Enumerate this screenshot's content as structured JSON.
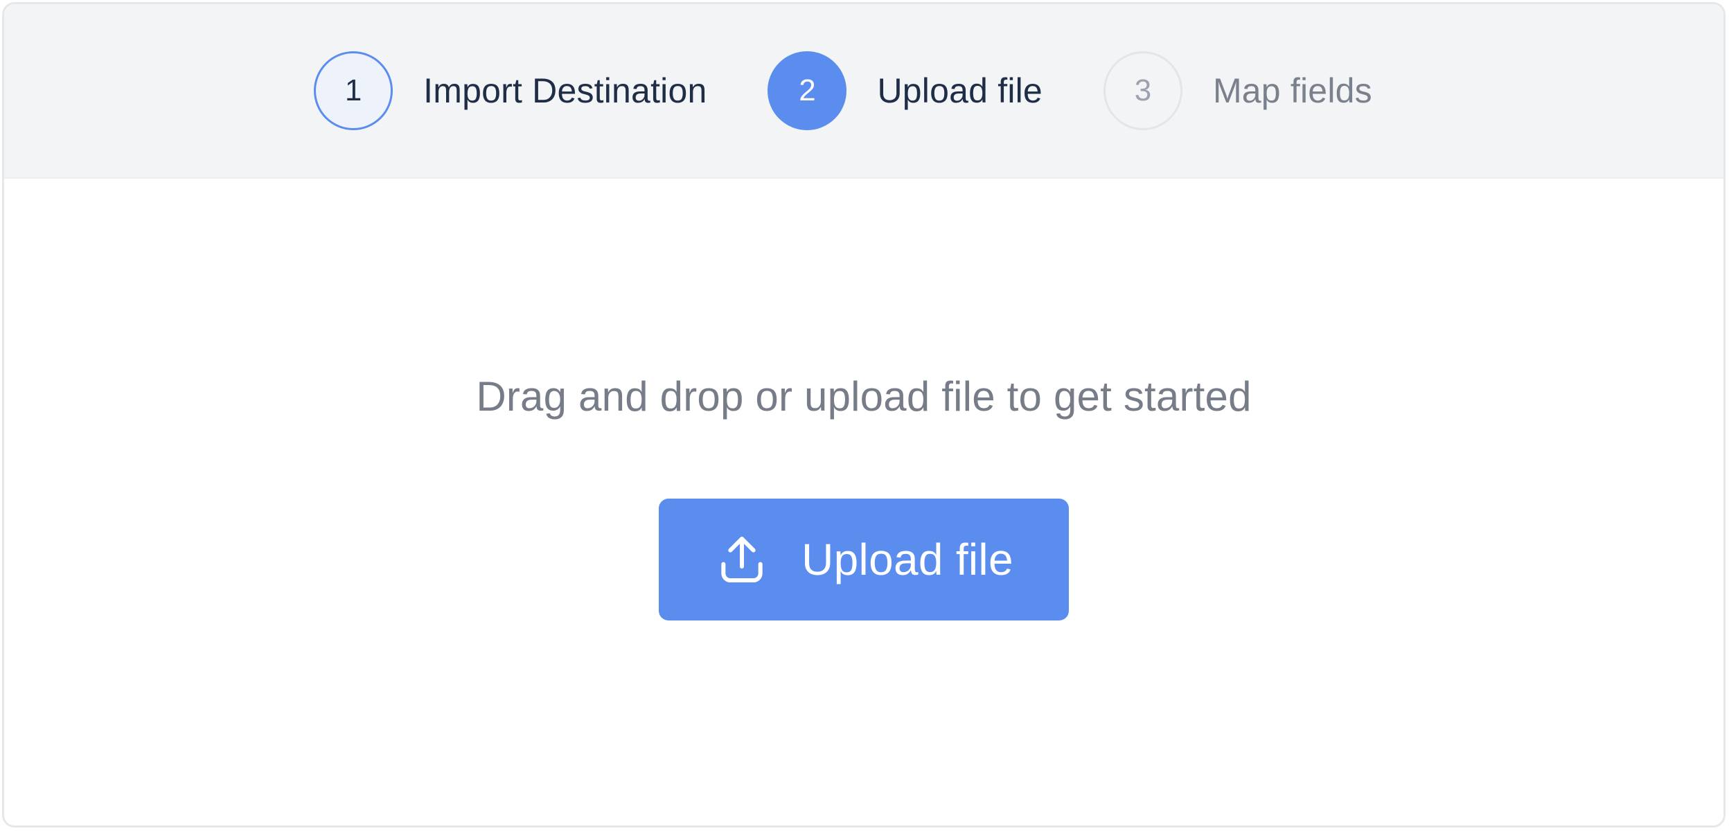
{
  "steps": [
    {
      "number": "1",
      "label": "Import Destination",
      "state": "done"
    },
    {
      "number": "2",
      "label": "Upload file",
      "state": "active"
    },
    {
      "number": "3",
      "label": "Map fields",
      "state": "pending"
    }
  ],
  "main": {
    "prompt": "Drag and drop or upload file to get started",
    "upload_button": {
      "label": "Upload file",
      "icon": "upload-icon"
    }
  },
  "colors": {
    "accent": "#5b8def",
    "header_bg": "#f3f4f6",
    "text_dark": "#1f2d47",
    "text_muted": "#767c88"
  }
}
